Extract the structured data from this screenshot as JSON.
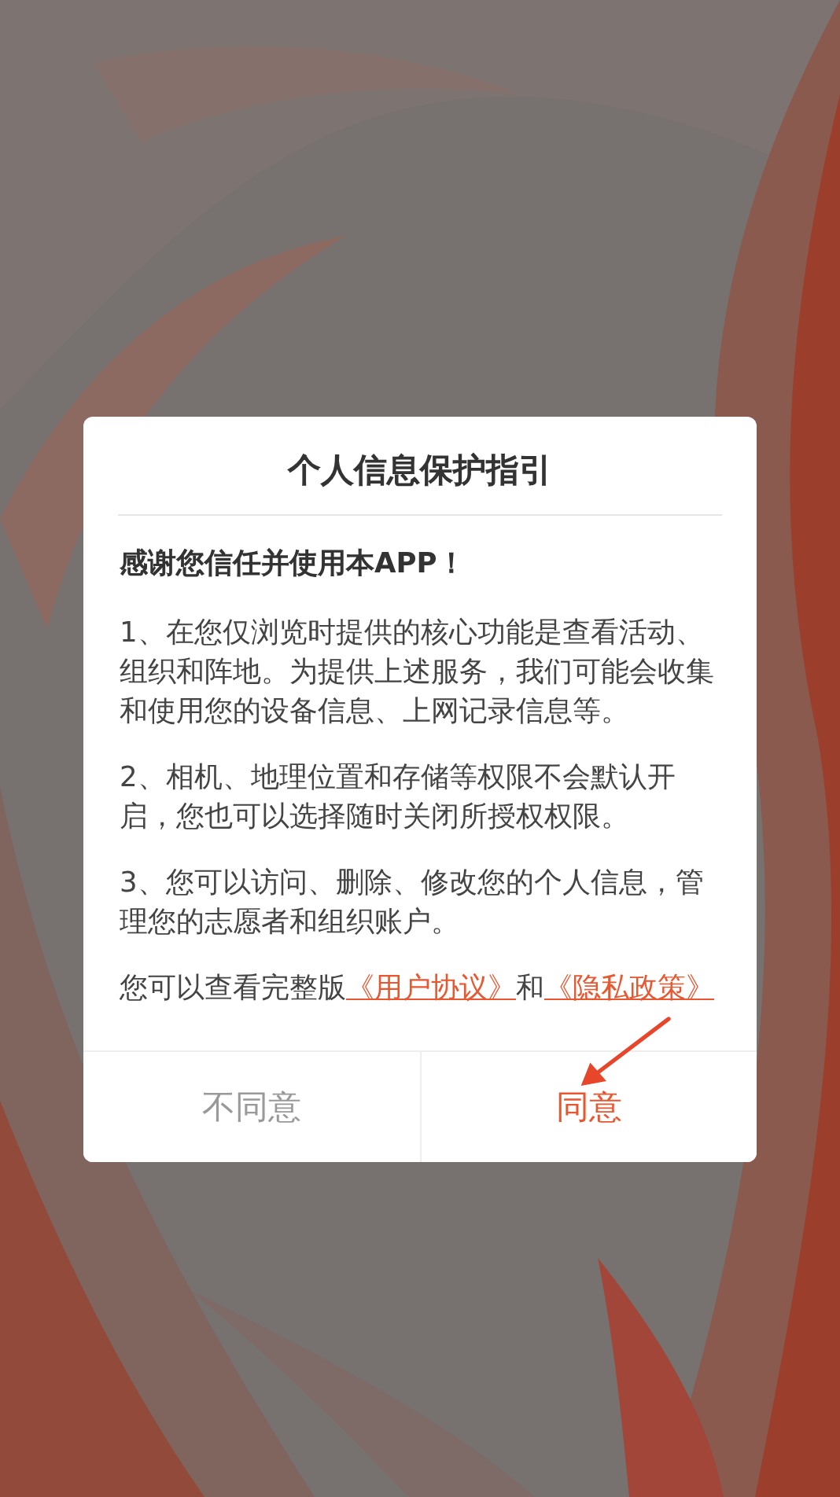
{
  "dialog": {
    "title": "个人信息保护指引",
    "greeting": "感谢您信任并使用本APP！",
    "paragraphs": [
      "1、在您仅浏览时提供的核心功能是查看活动、组织和阵地。为提供上述服务，我们可能会收集和使用您的设备信息、上网记录信息等。",
      "2、相机、地理位置和存储等权限不会默认开启，您也可以选择随时关闭所授权权限。",
      "3、您可以访问、删除、修改您的个人信息，管理您的志愿者和组织账户。"
    ],
    "consent_line": [
      {
        "kind": "text",
        "text": "您可以查看完整版"
      },
      {
        "kind": "link",
        "text": "《用户协议》"
      },
      {
        "kind": "text",
        "text": "和"
      },
      {
        "kind": "link",
        "text": "《隐私政策》"
      }
    ],
    "buttons": [
      {
        "label": "不同意",
        "primary": false
      },
      {
        "label": "同意",
        "primary": true
      }
    ]
  }
}
